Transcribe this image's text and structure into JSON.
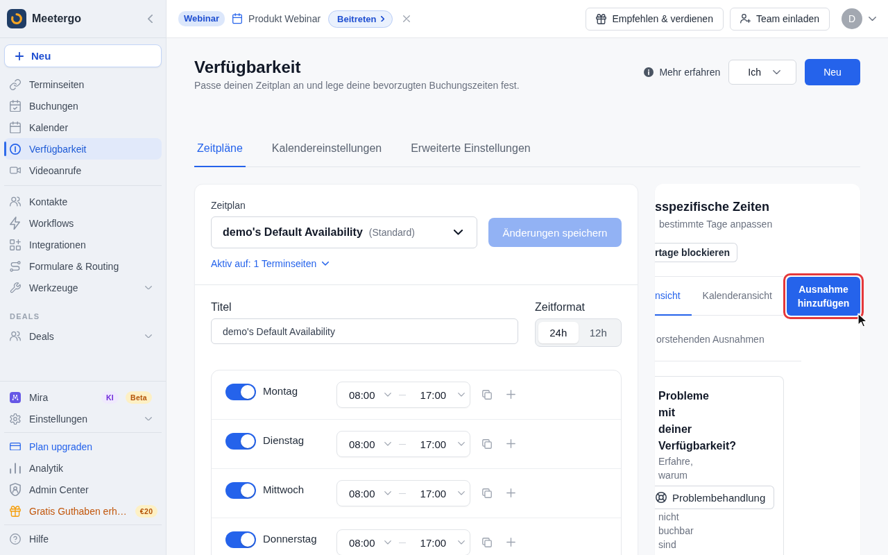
{
  "sidebar": {
    "brand": "Meetergo",
    "new_button": "Neu",
    "nav_groups": [
      {
        "items": [
          {
            "label": "Terminseiten",
            "selected": false
          },
          {
            "label": "Buchungen",
            "selected": false
          },
          {
            "label": "Kalender",
            "selected": false
          },
          {
            "label": "Verfügbarkeit",
            "selected": true
          },
          {
            "label": "Videoanrufe",
            "selected": false
          }
        ]
      },
      {
        "items": [
          {
            "label": "Kontakte",
            "selected": false
          },
          {
            "label": "Workflows",
            "selected": false
          },
          {
            "label": "Integrationen",
            "selected": false
          },
          {
            "label": "Formulare & Routing",
            "selected": false
          },
          {
            "label": "Werkzeuge",
            "selected": false,
            "expanded": false
          }
        ]
      },
      {
        "heading": "DEALS",
        "items": [
          {
            "label": "Deals",
            "selected": false,
            "expanded": false
          }
        ]
      }
    ],
    "footer_groups": [
      {
        "items": [
          {
            "label": "Mira",
            "selected": false,
            "badges": [
              {
                "label": "KI",
                "kind": "ai"
              },
              {
                "label": "Beta",
                "kind": "beta"
              }
            ]
          },
          {
            "label": "Einstellungen",
            "selected": false,
            "expanded": false
          }
        ]
      },
      {
        "items": [
          {
            "label": "Plan upgraden",
            "kind": "upgrade",
            "selected": false
          },
          {
            "label": "Analytik",
            "kind": "plain",
            "selected": false
          },
          {
            "label": "Admin Center",
            "kind": "plain",
            "selected": false
          },
          {
            "label": "Gratis Guthaben erh…",
            "kind": "promo",
            "selected": false,
            "badges": [
              {
                "label": "€20",
                "kind": "credit"
              }
            ]
          }
        ]
      },
      {
        "items": [
          {
            "label": "Hilfe",
            "selected": false
          }
        ]
      }
    ]
  },
  "topbar": {
    "event_tag": "Webinar",
    "event_title": "Produkt Webinar",
    "join_button": "Beitreten",
    "actions": [
      "Empfehlen & verdienen",
      "Team einladen"
    ],
    "avatar": "D"
  },
  "header": {
    "title": "Verfügbarkeit",
    "subtitle": "Passe deinen Zeitplan an und lege deine bevorzugten Buchungszeiten fest.",
    "learn_more": "Mehr erfahren",
    "owner_select": "Ich",
    "new_button": "Neu"
  },
  "tabs": [
    {
      "label": "Zeitpläne",
      "selected": true
    },
    {
      "label": "Kalendereinstellungen",
      "selected": false
    },
    {
      "label": "Erweiterte Einstellungen",
      "selected": false
    }
  ],
  "schedule": {
    "schedule_label": "Zeitplan",
    "schedule_select": {
      "value": "demo's Default Availability",
      "note": "(Standard)"
    },
    "save_button": {
      "label": "Änderungen speichern",
      "disabled": true
    },
    "active_link": "Aktiv auf: 1 Terminseiten",
    "title_label": "Titel",
    "title_value": "demo's Default Availability",
    "time_format": {
      "label": "Zeitformat",
      "options": [
        {
          "label": "24h",
          "selected": true
        },
        {
          "label": "12h",
          "selected": false
        }
      ]
    },
    "days": [
      {
        "name": "Montag",
        "on": true,
        "start": "08:00",
        "end": "17:00"
      },
      {
        "name": "Dienstag",
        "on": true,
        "start": "08:00",
        "end": "17:00"
      },
      {
        "name": "Mittwoch",
        "on": true,
        "start": "08:00",
        "end": "17:00"
      },
      {
        "name": "Donnerstag",
        "on": true,
        "start": "08:00",
        "end": "17:00"
      }
    ]
  },
  "date_overrides": {
    "title": "sspezifische Zeiten",
    "subtitle": "bestimmte Tage anpassen",
    "block_button": "rtage blockieren",
    "tabs": [
      {
        "label": "nsicht",
        "selected": true
      },
      {
        "label": "Kalenderansicht",
        "selected": false
      }
    ],
    "add_button": {
      "label": "Ausnahme hinzufügen",
      "highlighted": true
    },
    "empty_text": "orstehenden Ausnahmen",
    "help_card": {
      "title": "Probleme mit deiner Verfügbarkeit?",
      "text_before": "Erfahre, warum",
      "button": "Problembehandlung",
      "text_after": "nicht buchbar sind"
    }
  }
}
